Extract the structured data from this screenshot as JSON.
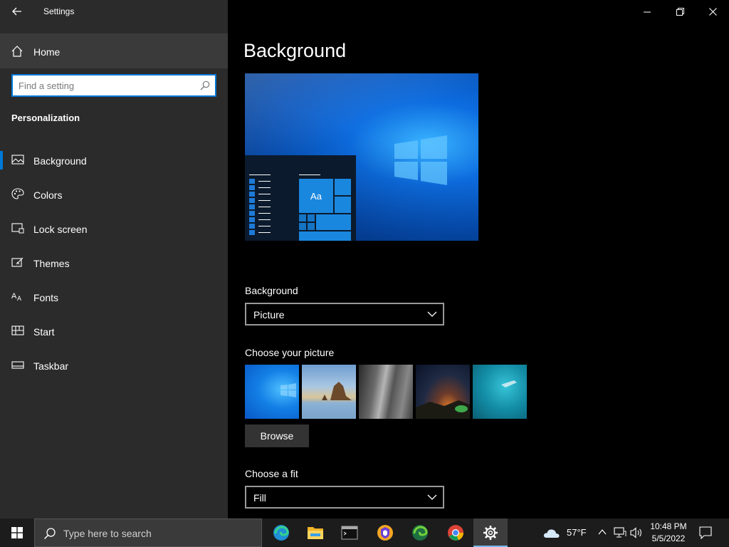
{
  "window": {
    "app_title": "Settings",
    "page_title": "Background"
  },
  "sidebar": {
    "home_label": "Home",
    "search_placeholder": "Find a setting",
    "section_heading": "Personalization",
    "items": [
      {
        "label": "Background",
        "icon": "picture-icon",
        "active": true
      },
      {
        "label": "Colors",
        "icon": "palette-icon",
        "active": false
      },
      {
        "label": "Lock screen",
        "icon": "lock-screen-icon",
        "active": false
      },
      {
        "label": "Themes",
        "icon": "themes-icon",
        "active": false
      },
      {
        "label": "Fonts",
        "icon": "fonts-icon",
        "active": false
      },
      {
        "label": "Start",
        "icon": "start-icon",
        "active": false
      },
      {
        "label": "Taskbar",
        "icon": "taskbar-icon",
        "active": false
      }
    ]
  },
  "preview": {
    "tile_label": "Aa"
  },
  "background_setting": {
    "label": "Background",
    "value": "Picture"
  },
  "picture_chooser": {
    "label": "Choose your picture",
    "thumbnails": [
      "windows-blue-wallpaper",
      "beach-rocks-wallpaper",
      "rock-cliff-wallpaper",
      "night-sky-wallpaper",
      "underwater-swimmer-wallpaper"
    ],
    "browse_label": "Browse"
  },
  "fit_setting": {
    "label": "Choose a fit",
    "value": "Fill"
  },
  "taskbar": {
    "search_placeholder": "Type here to search",
    "apps": [
      "edge-icon",
      "file-explorer-icon",
      "terminal-icon",
      "brave-icon",
      "edge-dev-icon",
      "chrome-icon",
      "settings-icon"
    ],
    "weather_temp": "57°F",
    "time": "10:48 PM",
    "date": "5/5/2022"
  },
  "colors": {
    "accent": "#0078d7",
    "sidebar_bg": "#2b2b2b",
    "main_bg": "#000000",
    "taskbar_bg": "#1c1c1c"
  }
}
